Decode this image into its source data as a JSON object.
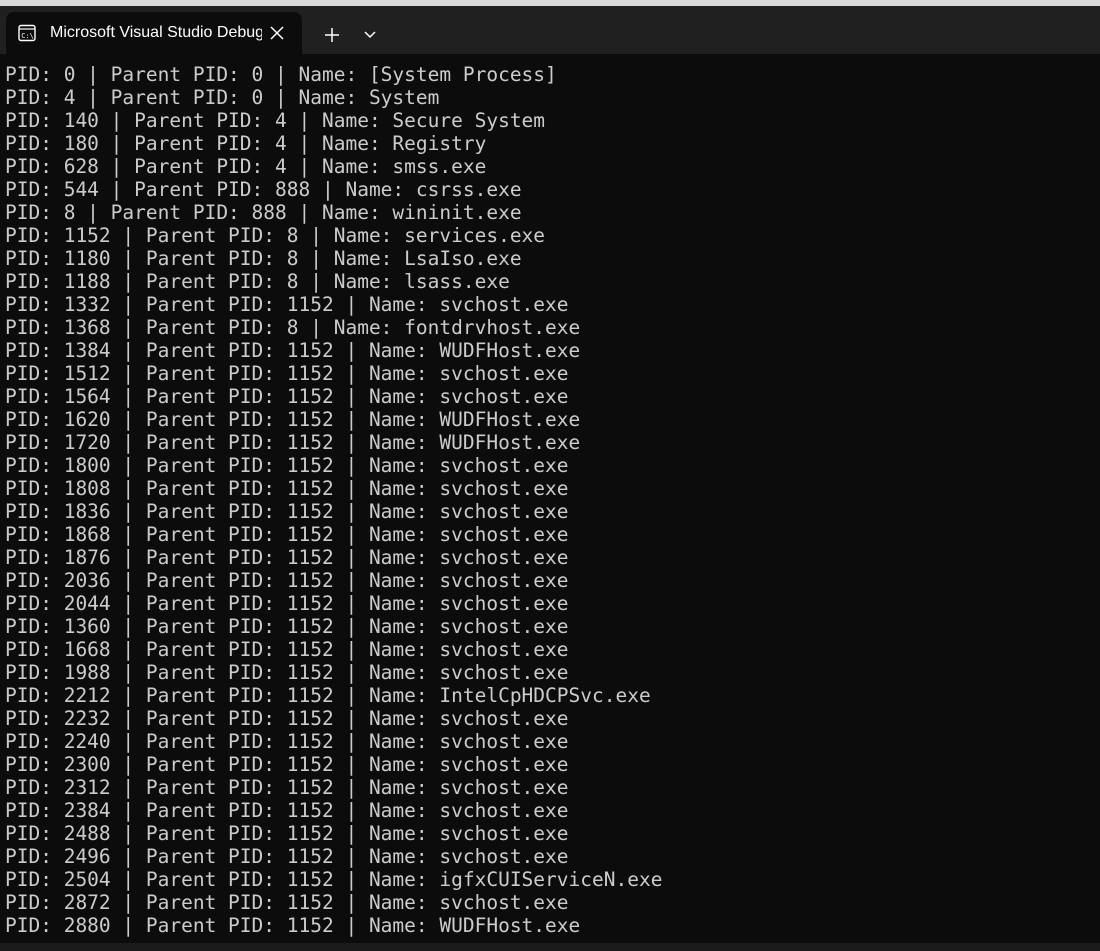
{
  "window": {
    "tab_title": "Microsoft Visual Studio Debug Console",
    "tab_icon": "console-app-icon",
    "close_icon": "close-icon",
    "new_tab_icon": "plus-icon",
    "dropdown_icon": "chevron-down-icon"
  },
  "colors": {
    "console_background": "#0c0c0c",
    "console_text": "#cccccc",
    "titlebar_background": "#202020",
    "tab_text": "#ffffff"
  },
  "console": {
    "lines": [
      "PID: 0 | Parent PID: 0 | Name: [System Process]",
      "PID: 4 | Parent PID: 0 | Name: System",
      "PID: 140 | Parent PID: 4 | Name: Secure System",
      "PID: 180 | Parent PID: 4 | Name: Registry",
      "PID: 628 | Parent PID: 4 | Name: smss.exe",
      "PID: 544 | Parent PID: 888 | Name: csrss.exe",
      "PID: 8 | Parent PID: 888 | Name: wininit.exe",
      "PID: 1152 | Parent PID: 8 | Name: services.exe",
      "PID: 1180 | Parent PID: 8 | Name: LsaIso.exe",
      "PID: 1188 | Parent PID: 8 | Name: lsass.exe",
      "PID: 1332 | Parent PID: 1152 | Name: svchost.exe",
      "PID: 1368 | Parent PID: 8 | Name: fontdrvhost.exe",
      "PID: 1384 | Parent PID: 1152 | Name: WUDFHost.exe",
      "PID: 1512 | Parent PID: 1152 | Name: svchost.exe",
      "PID: 1564 | Parent PID: 1152 | Name: svchost.exe",
      "PID: 1620 | Parent PID: 1152 | Name: WUDFHost.exe",
      "PID: 1720 | Parent PID: 1152 | Name: WUDFHost.exe",
      "PID: 1800 | Parent PID: 1152 | Name: svchost.exe",
      "PID: 1808 | Parent PID: 1152 | Name: svchost.exe",
      "PID: 1836 | Parent PID: 1152 | Name: svchost.exe",
      "PID: 1868 | Parent PID: 1152 | Name: svchost.exe",
      "PID: 1876 | Parent PID: 1152 | Name: svchost.exe",
      "PID: 2036 | Parent PID: 1152 | Name: svchost.exe",
      "PID: 2044 | Parent PID: 1152 | Name: svchost.exe",
      "PID: 1360 | Parent PID: 1152 | Name: svchost.exe",
      "PID: 1668 | Parent PID: 1152 | Name: svchost.exe",
      "PID: 1988 | Parent PID: 1152 | Name: svchost.exe",
      "PID: 2212 | Parent PID: 1152 | Name: IntelCpHDCPSvc.exe",
      "PID: 2232 | Parent PID: 1152 | Name: svchost.exe",
      "PID: 2240 | Parent PID: 1152 | Name: svchost.exe",
      "PID: 2300 | Parent PID: 1152 | Name: svchost.exe",
      "PID: 2312 | Parent PID: 1152 | Name: svchost.exe",
      "PID: 2384 | Parent PID: 1152 | Name: svchost.exe",
      "PID: 2488 | Parent PID: 1152 | Name: svchost.exe",
      "PID: 2496 | Parent PID: 1152 | Name: svchost.exe",
      "PID: 2504 | Parent PID: 1152 | Name: igfxCUIServiceN.exe",
      "PID: 2872 | Parent PID: 1152 | Name: svchost.exe",
      "PID: 2880 | Parent PID: 1152 | Name: WUDFHost.exe"
    ]
  }
}
